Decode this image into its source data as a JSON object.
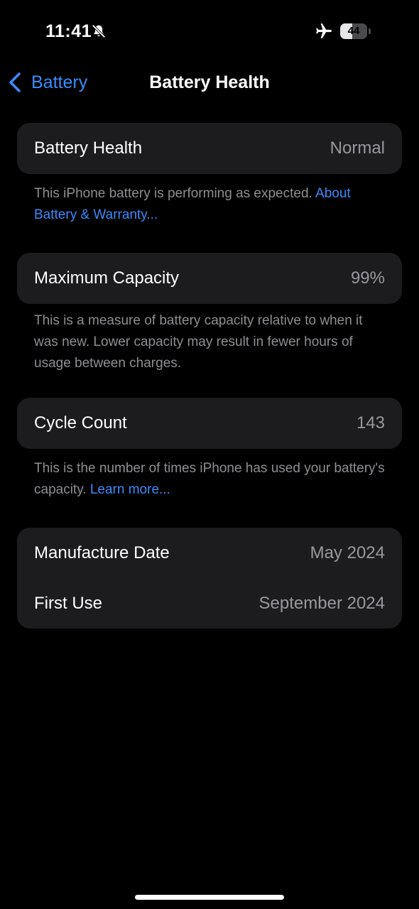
{
  "status_bar": {
    "time": "11:41",
    "battery_level": "44",
    "battery_fraction": 0.44,
    "icons": [
      "bell-slash-icon",
      "airplane-icon",
      "battery-icon"
    ]
  },
  "nav": {
    "back_label": "Battery",
    "title": "Battery Health"
  },
  "health": {
    "label": "Battery Health",
    "value": "Normal",
    "footnote": "This iPhone battery is performing as expected.",
    "link": "About Battery & Warranty..."
  },
  "capacity": {
    "label": "Maximum Capacity",
    "value": "99%",
    "footnote": "This is a measure of battery capacity relative to when it was new. Lower capacity may result in fewer hours of usage between charges."
  },
  "cycles": {
    "label": "Cycle Count",
    "value": "143",
    "footnote": "This is the number of times iPhone has used your battery's capacity.",
    "link": "Learn more..."
  },
  "dates": {
    "manufacture_label": "Manufacture Date",
    "manufacture_value": "May 2024",
    "first_use_label": "First Use",
    "first_use_value": "September 2024"
  },
  "colors": {
    "background": "#000000",
    "card": "#1c1c1e",
    "accent": "#3a8bfd",
    "secondary_text": "#8e8e93"
  }
}
